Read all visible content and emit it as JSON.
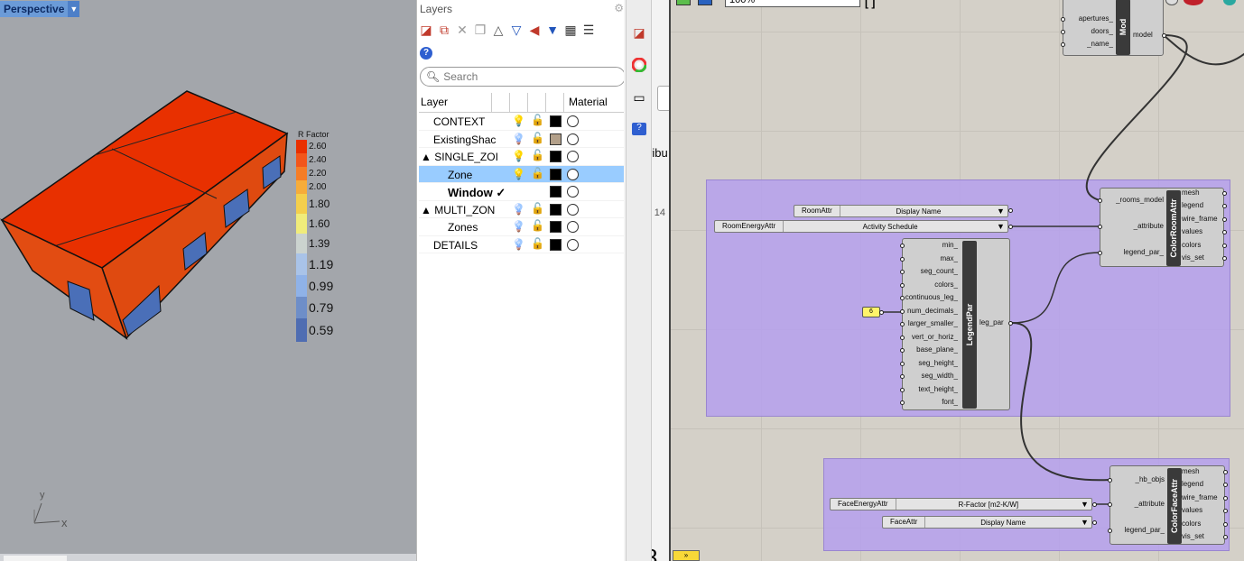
{
  "viewport": {
    "name": "Perspective",
    "legend": {
      "title": "R Factor",
      "values": [
        "2.60",
        "2.40",
        "2.20",
        "2.00",
        "1.80",
        "1.60",
        "1.39",
        "1.19",
        "0.99",
        "0.79",
        "0.59"
      ],
      "colors": [
        "#e92f00",
        "#f2561b",
        "#f67d26",
        "#f6ac3a",
        "#f4cf4c",
        "#f0ec7a",
        "#cbd3cf",
        "#a9c3e8",
        "#8fb2e8",
        "#6e8ec8",
        "#4f6db2"
      ]
    },
    "box_colors": {
      "top": "#e83000",
      "front": "#e14a10",
      "side": "#df4a12",
      "window": "#4a6fb8"
    },
    "axis_x": "x",
    "axis_y": "y"
  },
  "layers": {
    "title": "Layers",
    "search_placeholder": "Search",
    "col_layer": "Layer",
    "col_material": "Material",
    "rows": [
      {
        "name": "CONTEXT",
        "bulb": "💡",
        "swatch": "#000000"
      },
      {
        "name": "ExistingShac",
        "bulb": "💡",
        "swatch": "#b3a08a"
      },
      {
        "name": "▲ SINGLE_ZOI",
        "bulb": "💡",
        "swatch": "#000000"
      },
      {
        "name": "Zone",
        "bulb": "💡",
        "swatch": "#000000"
      },
      {
        "name": "Window ✓",
        "bulb": "",
        "swatch": "#000000"
      },
      {
        "name": "▲ MULTI_ZON",
        "bulb": "💡",
        "swatch": "#000000"
      },
      {
        "name": "Zones",
        "bulb": "💡",
        "swatch": "#000000"
      },
      {
        "name": "DETAILS",
        "bulb": "💡",
        "swatch": "#000000"
      }
    ]
  },
  "partial": {
    "text1": "ribu",
    "text2": "· 14",
    "text3": ") 8"
  },
  "gh": {
    "zoom": "100%",
    "top_comp": {
      "title": "Mod",
      "inputs": [
        "apertures_",
        "doors_",
        "_name_"
      ],
      "output": "model"
    },
    "color_room": {
      "title": "ColorRoomAttr",
      "inputs": [
        "_rooms_model",
        "_attribute",
        "legend_par_"
      ],
      "outputs": [
        "mesh",
        "legend",
        "wire_frame",
        "values",
        "colors",
        "vis_set"
      ]
    },
    "legend_par": {
      "title": "LegendPar",
      "inputs": [
        "min_",
        "max_",
        "seg_count_",
        "colors_",
        "continuous_leg_",
        "num_decimals_",
        "larger_smaller_",
        "vert_or_horiz_",
        "base_plane_",
        "seg_height_",
        "seg_width_",
        "text_height_",
        "font_"
      ],
      "output": "leg_par"
    },
    "color_face": {
      "title": "ColorFaceAttr",
      "inputs": [
        "_hb_objs",
        "_attribute",
        "legend_par_"
      ],
      "outputs": [
        "mesh",
        "legend",
        "wire_frame",
        "values",
        "colors",
        "vis_set"
      ]
    },
    "value_lists": {
      "room_attr": {
        "name": "RoomAttr",
        "value": "Display Name"
      },
      "room_energy": {
        "name": "RoomEnergyAttr",
        "value": "Activity Schedule"
      },
      "face_energy": {
        "name": "FaceEnergyAttr",
        "value": "R-Factor [m2-K/W]"
      },
      "face_attr": {
        "name": "FaceAttr",
        "value": "Display Name"
      }
    },
    "panel_value": "6"
  }
}
